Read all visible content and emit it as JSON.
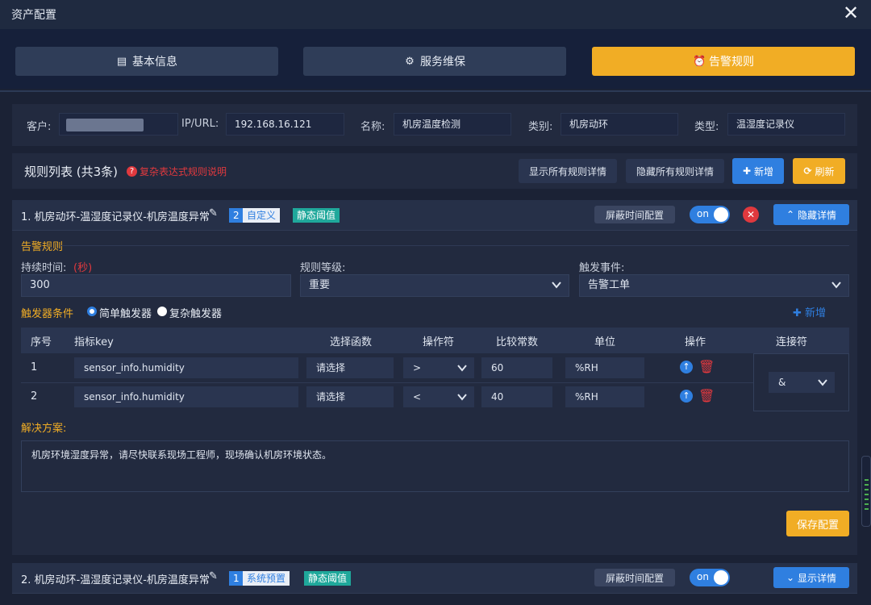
{
  "window": {
    "title": "资产配置",
    "close_symbol": "✕"
  },
  "tabs": [
    {
      "label": "基本信息",
      "icon": "clipboard-icon",
      "active": false
    },
    {
      "label": "服务维保",
      "icon": "gear-icon",
      "active": false
    },
    {
      "label": "告警规则",
      "icon": "alarm-icon",
      "active": true
    }
  ],
  "info": {
    "customer_label": "客户:",
    "customer_value": "",
    "ip_label": "IP/URL:",
    "ip_value": "192.168.16.121",
    "name_label": "名称:",
    "name_value": "机房温度检测",
    "category_label": "类别:",
    "category_value": "机房动环",
    "type_label": "类型:",
    "type_value": "温湿度记录仪"
  },
  "rule_list": {
    "title": "规则列表 (共3条)",
    "help_text": "复杂表达式规则说明",
    "show_all_label": "显示所有规则详情",
    "hide_all_label": "隐藏所有规则详情",
    "add_label": "新增",
    "refresh_label": "刷新"
  },
  "rule1": {
    "title": "1. 机房动环-温湿度记录仪-机房温度异常",
    "badge_num": "2",
    "badge_type": "自定义",
    "badge_threshold": "静态阈值",
    "mask_label": "屏蔽时间配置",
    "toggle_label": "on",
    "hide_details_label": "隐藏详情",
    "section_title": "告警规则",
    "duration_label": "持续时间:",
    "duration_unit": "(秒)",
    "duration_value": "300",
    "level_label": "规则等级:",
    "level_value": "重要",
    "event_label": "触发事件:",
    "event_value": "告警工单",
    "trigger_label": "触发器条件",
    "simple_trigger": "简单触发器",
    "complex_trigger": "复杂触发器",
    "add_condition": "新增",
    "table_headers": [
      "序号",
      "指标key",
      "选择函数",
      "操作符",
      "比较常数",
      "单位",
      "操作",
      "连接符"
    ],
    "rows": [
      {
        "index": "1",
        "key": "sensor_info.humidity",
        "func": "请选择",
        "op": ">",
        "const": "60",
        "unit": "%RH"
      },
      {
        "index": "2",
        "key": "sensor_info.humidity",
        "func": "请选择",
        "op": "<",
        "const": "40",
        "unit": "%RH"
      }
    ],
    "connector": "&",
    "solution_label": "解决方案:",
    "solution_text": "机房环境湿度异常，请尽快联系现场工程师，现场确认机房环境状态。",
    "save_label": "保存配置"
  },
  "rule2": {
    "title": "2. 机房动环-温湿度记录仪-机房温度异常",
    "badge_num": "1",
    "badge_type": "系统预置",
    "badge_threshold": "静态阈值",
    "mask_label": "屏蔽时间配置",
    "toggle_label": "on",
    "show_details_label": "显示详情"
  },
  "colors": {
    "accent": "#f1ad25",
    "primary": "#2f7fe0",
    "danger": "#e0393e",
    "teal": "#1fa89b"
  }
}
